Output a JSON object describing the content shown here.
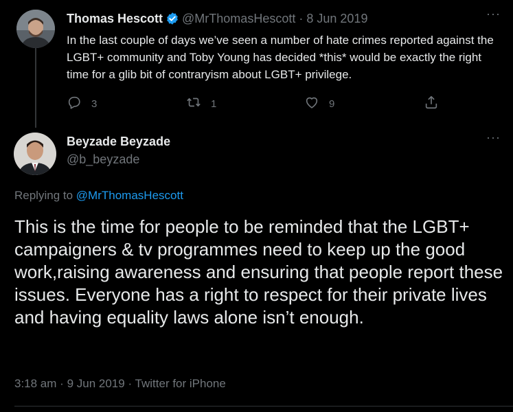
{
  "parent_tweet": {
    "author_name": "Thomas Hescott",
    "handle": "@MrThomasHescott",
    "separator": "·",
    "date": "8 Jun 2019",
    "text": "In the last couple of days we’ve seen a number of hate crimes reported against the LGBT+ community and Toby Young has decided *this* would be exactly the right time for a glib bit of contraryism about LGBT+ privilege.",
    "reply_count": "3",
    "retweet_count": "1",
    "like_count": "9",
    "verified": true
  },
  "main_tweet": {
    "author_name": "Beyzade Beyzade",
    "handle": "@b_beyzade",
    "replying_label": "Replying to",
    "replying_to": "@MrThomasHescott",
    "text": "This is the time for people to be reminded that the LGBT+ campaigners & tv programmes need to keep up the good work,raising awareness and ensuring that people report these issues. Everyone has a right to respect for their private lives and having equality laws alone isn’t enough.",
    "time": "3:18 am",
    "separator": "·",
    "date": "9 Jun 2019",
    "separator2": "·",
    "client": "Twitter for iPhone"
  },
  "more_label": "···",
  "icons": [
    "verified-badge-icon",
    "reply-icon",
    "retweet-icon",
    "like-icon",
    "share-icon",
    "more-icon"
  ],
  "colors": {
    "background": "#000000",
    "text": "#e7e9ea",
    "muted": "#71767b",
    "link": "#1d9bf0",
    "verified": "#1d9bf0"
  }
}
